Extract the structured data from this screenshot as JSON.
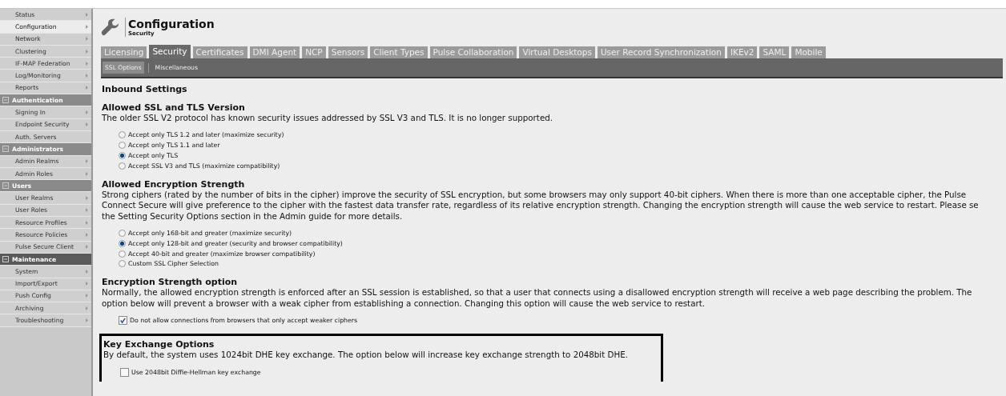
{
  "sidebar": {
    "groups": [
      {
        "items": [
          {
            "label": "Status",
            "selected": false,
            "arrow": true
          },
          {
            "label": "Configuration",
            "selected": true,
            "arrow": true
          },
          {
            "label": "Network",
            "selected": false,
            "arrow": true
          },
          {
            "label": "Clustering",
            "selected": false,
            "arrow": true
          },
          {
            "label": "IF-MAP Federation",
            "selected": false,
            "arrow": true
          },
          {
            "label": "Log/Monitoring",
            "selected": false,
            "arrow": true
          },
          {
            "label": "Reports",
            "selected": false,
            "arrow": true
          }
        ]
      },
      {
        "header": "Authentication",
        "active": false,
        "items": [
          {
            "label": "Signing In",
            "selected": false,
            "arrow": true
          },
          {
            "label": "Endpoint Security",
            "selected": false,
            "arrow": true
          },
          {
            "label": "Auth. Servers",
            "selected": false,
            "arrow": false
          }
        ]
      },
      {
        "header": "Administrators",
        "active": false,
        "items": [
          {
            "label": "Admin Realms",
            "selected": false,
            "arrow": true
          },
          {
            "label": "Admin Roles",
            "selected": false,
            "arrow": true
          }
        ]
      },
      {
        "header": "Users",
        "active": false,
        "items": [
          {
            "label": "User Realms",
            "selected": false,
            "arrow": true
          },
          {
            "label": "User Roles",
            "selected": false,
            "arrow": true
          },
          {
            "label": "Resource Profiles",
            "selected": false,
            "arrow": true
          },
          {
            "label": "Resource Policies",
            "selected": false,
            "arrow": true
          },
          {
            "label": "Pulse Secure Client",
            "selected": false,
            "arrow": true
          }
        ]
      },
      {
        "header": "Maintenance",
        "active": true,
        "items": [
          {
            "label": "System",
            "selected": false,
            "arrow": true
          },
          {
            "label": "Import/Export",
            "selected": false,
            "arrow": true
          },
          {
            "label": "Push Config",
            "selected": false,
            "arrow": true
          },
          {
            "label": "Archiving",
            "selected": false,
            "arrow": true
          },
          {
            "label": "Troubleshooting",
            "selected": false,
            "arrow": true
          }
        ]
      }
    ]
  },
  "header": {
    "title": "Configuration",
    "subtitle": "Security"
  },
  "tabs": [
    {
      "label": "Licensing",
      "selected": false
    },
    {
      "label": "Security",
      "selected": true
    },
    {
      "label": "Certificates",
      "selected": false
    },
    {
      "label": "DMI Agent",
      "selected": false
    },
    {
      "label": "NCP",
      "selected": false
    },
    {
      "label": "Sensors",
      "selected": false
    },
    {
      "label": "Client Types",
      "selected": false
    },
    {
      "label": "Pulse Collaboration",
      "selected": false
    },
    {
      "label": "Virtual Desktops",
      "selected": false
    },
    {
      "label": "User Record Synchronization",
      "selected": false
    },
    {
      "label": "IKEv2",
      "selected": false
    },
    {
      "label": "SAML",
      "selected": false
    },
    {
      "label": "Mobile",
      "selected": false
    }
  ],
  "subtabs": [
    {
      "label": "SSL Options",
      "selected": true
    },
    {
      "label": "Miscellaneous",
      "selected": false
    }
  ],
  "page_heading": "Inbound Settings",
  "sections": [
    {
      "title": "Allowed SSL and TLS Version",
      "boxed": false,
      "description": [
        "The older SSL V2 protocol has known security issues addressed by SSL V3 and TLS. It is no longer supported."
      ],
      "kind": "radio",
      "options": [
        {
          "label": "Accept only TLS 1.2 and later (maximize security)",
          "selected": false
        },
        {
          "label": "Accept only TLS 1.1 and later",
          "selected": false
        },
        {
          "label": "Accept only TLS",
          "selected": true
        },
        {
          "label": "Accept SSL V3 and TLS (maximize compatibility)",
          "selected": false
        }
      ]
    },
    {
      "title": "Allowed Encryption Strength",
      "boxed": false,
      "description": [
        "Strong ciphers (rated by the number of bits in the cipher) improve the security of SSL encryption, but some browsers may only support 40-bit ciphers. When there is more than one acceptable cipher, the Pulse",
        "Connect Secure will give preference to the cipher with the fastest data transfer rate, regardless of its relative encryption strength. Changing the encryption strength will cause the web service to restart. Please se",
        "the Setting Security Options section in the Admin guide for more details."
      ],
      "kind": "radio",
      "options": [
        {
          "label": "Accept only 168-bit and greater (maximize security)",
          "selected": false
        },
        {
          "label": "Accept only 128-bit and greater (security and browser compatibility)",
          "selected": true
        },
        {
          "label": "Accept 40-bit and greater (maximize browser compatibility)",
          "selected": false
        },
        {
          "label": "Custom SSL Cipher Selection",
          "selected": false
        }
      ]
    },
    {
      "title": "Encryption Strength option",
      "boxed": false,
      "description": [
        "Normally, the allowed encryption strength is enforced after an SSL session is established, so that a user that connects using a disallowed encryption strength will receive a web page describing the problem. The",
        "option below will prevent a browser with a weak cipher from establishing a connection. Changing this option will cause the web service to restart."
      ],
      "kind": "checkbox",
      "options": [
        {
          "label": "Do not allow connections from browsers that only accept weaker ciphers",
          "checked": true
        }
      ]
    },
    {
      "title": "Key Exchange Options",
      "boxed": true,
      "description": [
        "By default, the system uses 1024bit DHE key exchange. The option below will increase key exchange strength to 2048bit DHE."
      ],
      "kind": "checkbox",
      "options": [
        {
          "label": "Use 2048bit Diffie-Hellman key exchange",
          "checked": false
        }
      ]
    }
  ]
}
